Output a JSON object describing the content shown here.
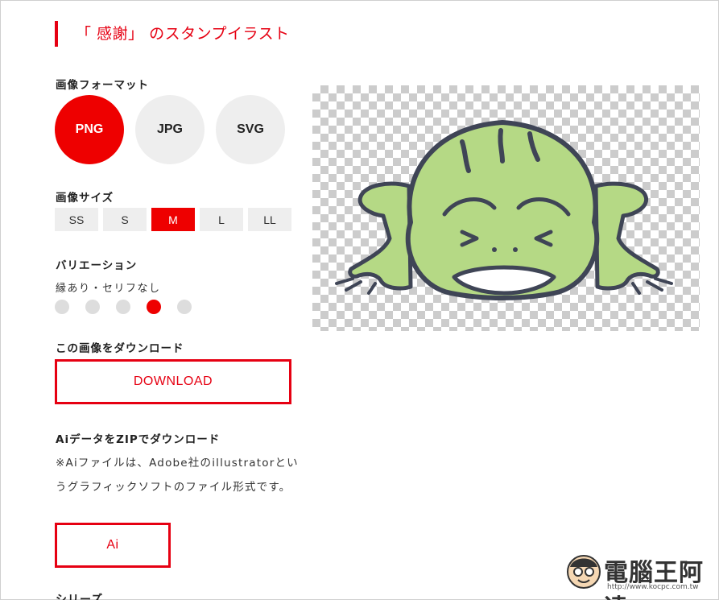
{
  "page": {
    "title": "「 感謝」 のスタンプイラスト"
  },
  "format": {
    "label": "画像フォーマット",
    "options": [
      "PNG",
      "JPG",
      "SVG"
    ],
    "selected": "PNG"
  },
  "size": {
    "label": "画像サイズ",
    "options": [
      "SS",
      "S",
      "M",
      "L",
      "LL"
    ],
    "selected": "M"
  },
  "variation": {
    "label": "バリエーション",
    "current_name": "縁あり・セリフなし",
    "count": 5,
    "selected_index": 3
  },
  "download": {
    "label": "この画像をダウンロード",
    "button": "DOWNLOAD"
  },
  "ai": {
    "label": "AiデータをZIPでダウンロード",
    "note": "※Aiファイルは、Adobe社のillustratorというグラフィックソフトのファイル形式です。",
    "button": "Ai"
  },
  "next_section": {
    "label": "シリーズ"
  },
  "preview": {
    "description_icon": "frog-illustration",
    "colors": {
      "body": "#b5d985",
      "outline": "#3f4556",
      "mouth": "#ffffff"
    }
  },
  "watermark": {
    "text": "電腦王阿達",
    "url": "http://www.kocpc.com.tw"
  },
  "colors": {
    "accent": "#e60012",
    "inactive": "#eeeeee",
    "dot": "#dddddd"
  }
}
